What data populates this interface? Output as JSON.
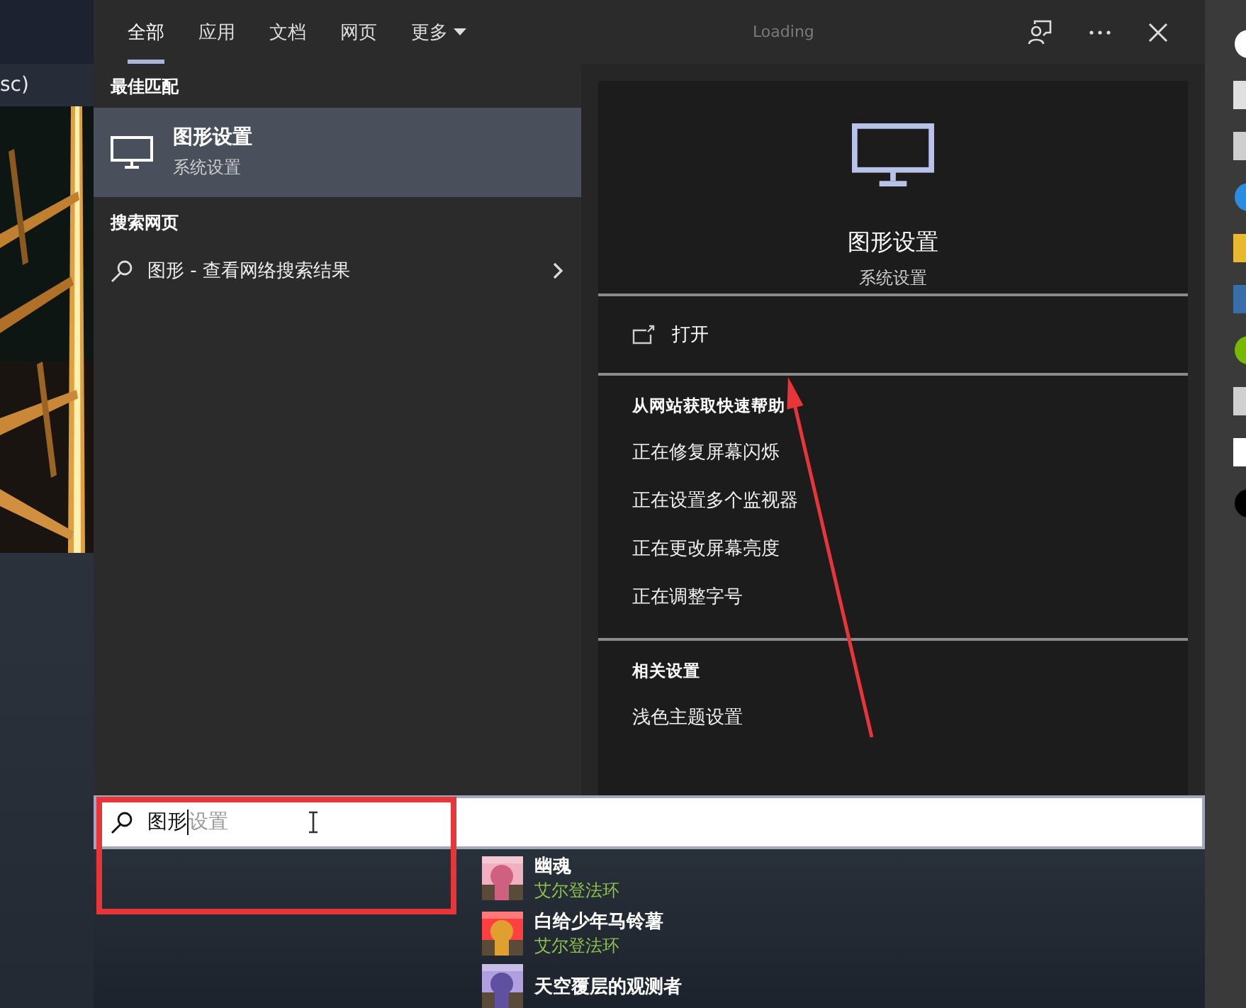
{
  "background": {
    "label": "sc)"
  },
  "tabs": [
    {
      "label": "全部",
      "selected": true,
      "kind": "tab"
    },
    {
      "label": "应用",
      "selected": false,
      "kind": "tab"
    },
    {
      "label": "文档",
      "selected": false,
      "kind": "tab"
    },
    {
      "label": "网页",
      "selected": false,
      "kind": "tab"
    },
    {
      "label": "更多",
      "selected": false,
      "kind": "dropdown"
    }
  ],
  "status": "Loading",
  "best_match": {
    "heading": "最佳匹配",
    "title": "图形设置",
    "subtitle": "系统设置",
    "selected": true
  },
  "web_search": {
    "heading": "搜索网页",
    "label": "图形 - 查看网络搜索结果"
  },
  "preview": {
    "title": "图形设置",
    "subtitle": "系统设置",
    "actions": [
      {
        "label": "打开"
      }
    ],
    "sections": [
      {
        "heading": "从网站获取快速帮助",
        "links": [
          "正在修复屏幕闪烁",
          "正在设置多个监视器",
          "正在更改屏幕亮度",
          "正在调整字号"
        ]
      },
      {
        "heading": "相关设置",
        "links": [
          "浅色主题设置"
        ]
      }
    ]
  },
  "search": {
    "value": "图形",
    "completion": "设置"
  },
  "games": [
    {
      "title": "幽魂",
      "subtitle": "艾尔登法环"
    },
    {
      "title": "白给少年马铃薯",
      "subtitle": "艾尔登法环"
    },
    {
      "title": "天空覆层的观测者"
    }
  ]
}
